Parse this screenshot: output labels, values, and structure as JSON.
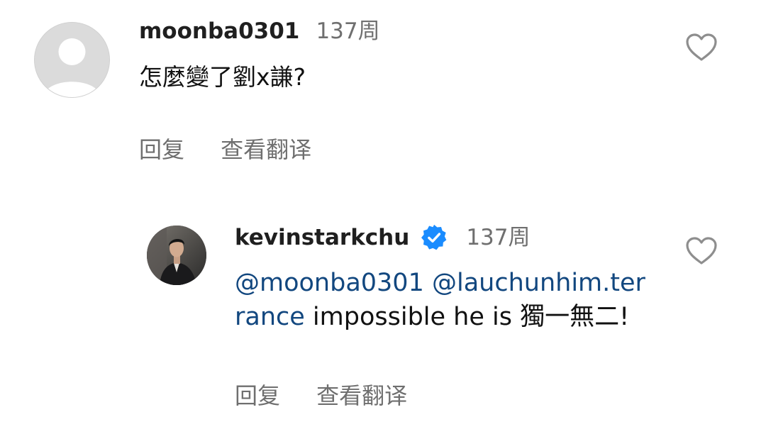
{
  "comment": {
    "avatar": "default-user-avatar",
    "username": "moonba0301",
    "time": "137周",
    "text": "怎麼變了劉x謙?",
    "actions": {
      "reply": "回复",
      "translate": "查看翻译"
    },
    "like_icon": "heart-outline-icon"
  },
  "reply": {
    "avatar": "profile-photo",
    "username": "kevinstarkchu",
    "verified_icon": "verified-badge-icon",
    "verified_color": "#1a8cff",
    "time": "137周",
    "mention_1": "@moonba0301",
    "mention_2": "@lauchunhim.terrance",
    "text": " impossible he is 獨一無二!",
    "actions": {
      "reply": "回复",
      "translate": "查看翻译"
    },
    "like_icon": "heart-outline-icon"
  },
  "colors": {
    "mention": "#12477f",
    "secondary_text": "#6f6f6f"
  }
}
